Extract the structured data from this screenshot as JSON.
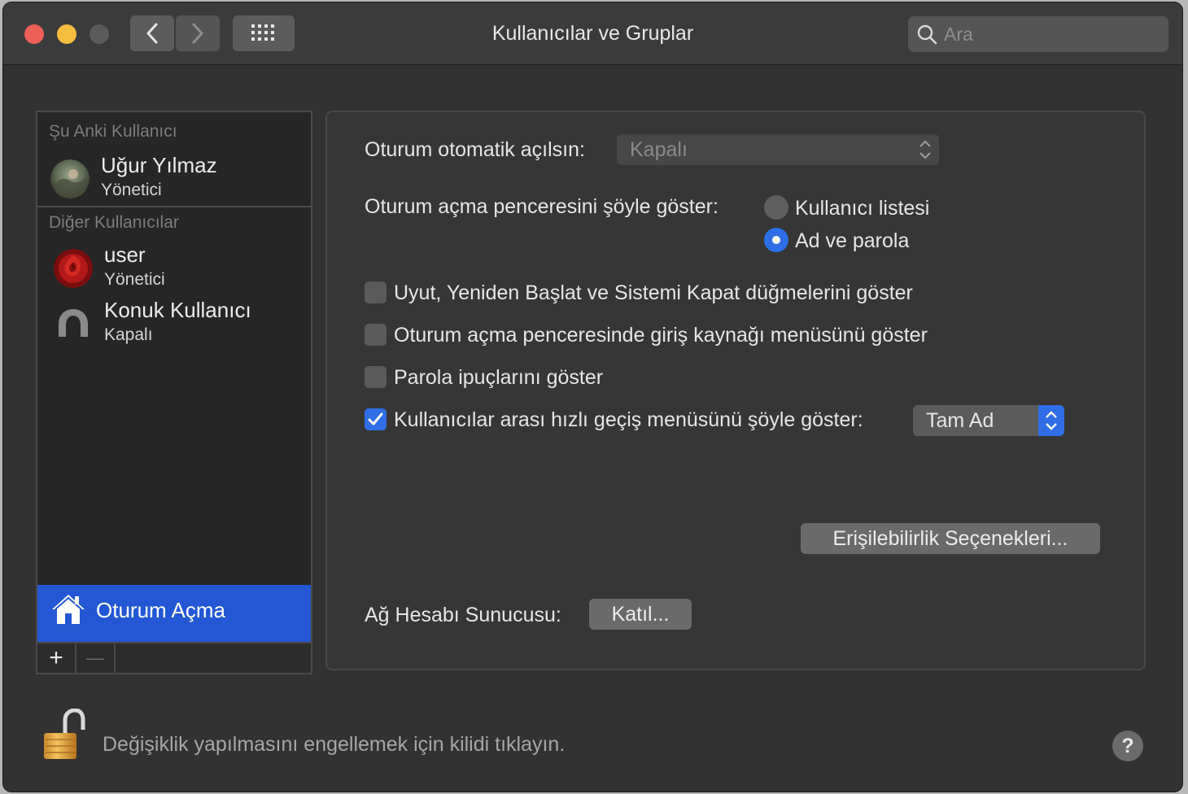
{
  "window": {
    "title": "Kullanıcılar ve Gruplar",
    "search_placeholder": "Ara"
  },
  "sidebar": {
    "current_header": "Şu Anki Kullanıcı",
    "current_user": {
      "name": "Uğur Yılmaz",
      "role": "Yönetici"
    },
    "other_header": "Diğer Kullanıcılar",
    "other_users": [
      {
        "name": "user",
        "role": "Yönetici"
      },
      {
        "name": "Konuk Kullanıcı",
        "role": "Kapalı"
      }
    ],
    "login_options_label": "Oturum Açma",
    "add_symbol": "+",
    "remove_symbol": "—"
  },
  "main": {
    "auto_login_label": "Oturum otomatik açılsın:",
    "auto_login_value": "Kapalı",
    "display_label": "Oturum açma penceresini şöyle göster:",
    "display_options": [
      {
        "label": "Kullanıcı listesi",
        "selected": false
      },
      {
        "label": "Ad ve parola",
        "selected": true
      }
    ],
    "checkboxes": [
      {
        "label": "Uyut, Yeniden Başlat ve Sistemi Kapat düğmelerini göster",
        "checked": false
      },
      {
        "label": "Oturum açma penceresinde giriş kaynağı menüsünü göster",
        "checked": false
      },
      {
        "label": "Parola ipuçlarını göster",
        "checked": false
      },
      {
        "label": "Kullanıcılar arası hızlı geçiş menüsünü şöyle göster:",
        "checked": true
      }
    ],
    "fast_switch_value": "Tam Ad",
    "accessibility_button": "Erişilebilirlik Seçenekleri...",
    "network_label": "Ağ Hesabı Sunucusu:",
    "join_button": "Katıl..."
  },
  "footer": {
    "lock_text": "Değişiklik yapılmasını engellemek için kilidi tıklayın.",
    "help_symbol": "?"
  },
  "colors": {
    "accent": "#2f6ee6",
    "selection": "#2357d3",
    "window_bg": "#323232"
  }
}
